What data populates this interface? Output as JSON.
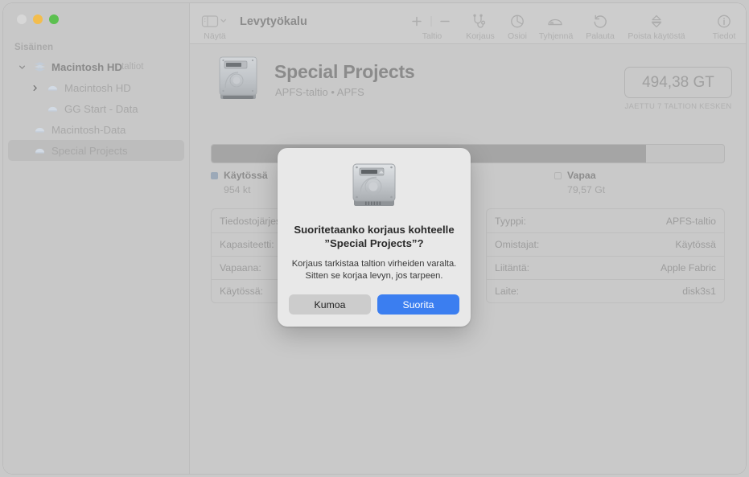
{
  "window": {
    "traffic_lights": [
      "close",
      "minimize",
      "zoom"
    ]
  },
  "toolbar": {
    "app_title": "Levytyökalu",
    "view_label": "Näytä",
    "items": [
      {
        "label": "Taltio",
        "icon": "plus-minus-icon"
      },
      {
        "label": "Korjaus",
        "icon": "stethoscope-icon"
      },
      {
        "label": "Osioi",
        "icon": "pie-chart-icon"
      },
      {
        "label": "Tyhjennä",
        "icon": "erase-disk-icon"
      },
      {
        "label": "Palauta",
        "icon": "restore-arrow-icon"
      },
      {
        "label": "Poista käytöstä",
        "icon": "unmount-icon"
      },
      {
        "label": "Tiedot",
        "icon": "info-circle-icon"
      }
    ]
  },
  "sidebar": {
    "section_title": "Sisäinen",
    "items": [
      {
        "label": "Macintosh HD",
        "sub": "taltiot",
        "level": 0,
        "disclosure": "expanded",
        "icon": "disk-stack-icon",
        "selected": false
      },
      {
        "label": "Macintosh HD",
        "sub": "",
        "level": 1,
        "disclosure": "collapsed",
        "icon": "volume-icon",
        "selected": false
      },
      {
        "label": "GG Start - Data",
        "sub": "",
        "level": 2,
        "disclosure": "none",
        "icon": "volume-icon",
        "selected": false
      },
      {
        "label": "Macintosh-Data",
        "sub": "",
        "level": 1,
        "disclosure": "none",
        "icon": "volume-icon",
        "selected": false
      },
      {
        "label": "Special Projects",
        "sub": "",
        "level": 1,
        "disclosure": "none",
        "icon": "volume-icon",
        "selected": true
      }
    ]
  },
  "main": {
    "volume_icon": "hard-drive-icon",
    "volume_name": "Special Projects",
    "volume_subtitle": "APFS-taltio • APFS",
    "capacity_value": "494,38 GT",
    "capacity_note": "JAETTU 7 TALTION KESKEN",
    "usage_bar": {
      "used_percent": 84.7,
      "used_color": "#a5a5a5",
      "free_color": "#c4c4c4"
    },
    "legend": [
      {
        "name": "Käytössä",
        "value": "954 kt",
        "swatch": "used"
      },
      {
        "name": "Vapaa",
        "value": "79,57 Gt",
        "swatch": "free"
      }
    ],
    "info_left": [
      {
        "key": "Tiedostojärjestelmä:",
        "value": ""
      },
      {
        "key": "Kapasiteetti:",
        "value": ""
      },
      {
        "key": "Vapaana:",
        "value": ""
      },
      {
        "key": "Käytössä:",
        "value": ""
      }
    ],
    "info_right": [
      {
        "key": "Tyyppi:",
        "value": "APFS-taltio"
      },
      {
        "key": "Omistajat:",
        "value": "Käytössä"
      },
      {
        "key": "Liitäntä:",
        "value": "Apple Fabric"
      },
      {
        "key": "Laite:",
        "value": "disk3s1"
      }
    ]
  },
  "dialog": {
    "icon": "hard-drive-icon",
    "title_line1": "Suoritetaanko korjaus kohteelle",
    "title_line2": "”Special Projects”?",
    "body_line1": "Korjaus tarkistaa taltion virheiden varalta.",
    "body_line2": "Sitten se korjaa levyn, jos tarpeen.",
    "cancel_label": "Kumoa",
    "confirm_label": "Suorita",
    "confirm_color": "#3b7ef0"
  }
}
